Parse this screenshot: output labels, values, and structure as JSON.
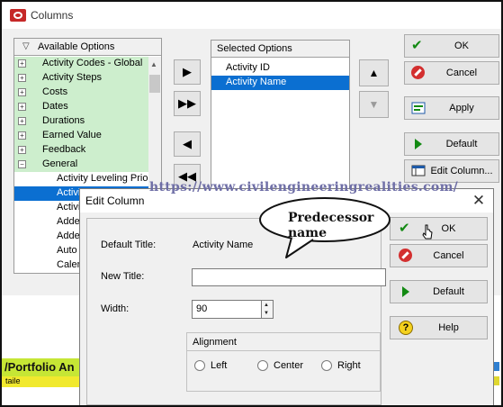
{
  "columns_window": {
    "title": "Columns",
    "available_header": "Available Options",
    "available_items": [
      {
        "label": "Activity Codes - Global",
        "kind": "category",
        "expander": "+"
      },
      {
        "label": "Activity Steps",
        "kind": "category",
        "expander": "+"
      },
      {
        "label": "Costs",
        "kind": "category",
        "expander": "+"
      },
      {
        "label": "Dates",
        "kind": "category",
        "expander": "+"
      },
      {
        "label": "Durations",
        "kind": "category",
        "expander": "+"
      },
      {
        "label": "Earned Value",
        "kind": "category",
        "expander": "+"
      },
      {
        "label": "Feedback",
        "kind": "category",
        "expander": "+"
      },
      {
        "label": "General",
        "kind": "category",
        "expander": "−"
      },
      {
        "label": "Activity Leveling Prio",
        "kind": "child"
      },
      {
        "label": "Activi",
        "kind": "child",
        "selected": true
      },
      {
        "label": "Activi",
        "kind": "child"
      },
      {
        "label": "Adde",
        "kind": "child"
      },
      {
        "label": "Adde",
        "kind": "child"
      },
      {
        "label": "Auto",
        "kind": "child"
      },
      {
        "label": "Calen",
        "kind": "child"
      }
    ],
    "move_buttons": [
      "▶",
      "▶▶",
      "◀",
      "◀◀"
    ],
    "selected_header": "Selected Options",
    "selected_items": [
      {
        "label": "Activity ID"
      },
      {
        "label": "Activity Name",
        "selected": true
      }
    ],
    "order_buttons": [
      "▲",
      "▼"
    ],
    "buttons": {
      "ok": "OK",
      "cancel": "Cancel",
      "apply": "Apply",
      "default": "Default",
      "edit_column": "Edit Column..."
    }
  },
  "background": {
    "bar_text": "/Portfolio An",
    "bar_text2": "taile"
  },
  "edit_dialog": {
    "title": "Edit Column",
    "close_glyph": "✕",
    "default_title_label": "Default Title:",
    "default_title_value": "Activity Name",
    "new_title_label": "New Title:",
    "new_title_value": "",
    "width_label": "Width:",
    "width_value": "90",
    "alignment_label": "Alignment",
    "alignment_options": [
      "Left",
      "Center",
      "Right"
    ],
    "buttons": {
      "ok": "OK",
      "cancel": "Cancel",
      "default": "Default",
      "help": "Help"
    }
  },
  "annotations": {
    "watermark": "https://www.civilengineeringrealities.com/",
    "callout_line1": "Predecessor",
    "callout_line2": "name"
  },
  "colors": {
    "category_bg": "#cdeecd",
    "selection": "#0b6fd1",
    "check_green": "#138a13",
    "cancel_red": "#d32f2f"
  }
}
